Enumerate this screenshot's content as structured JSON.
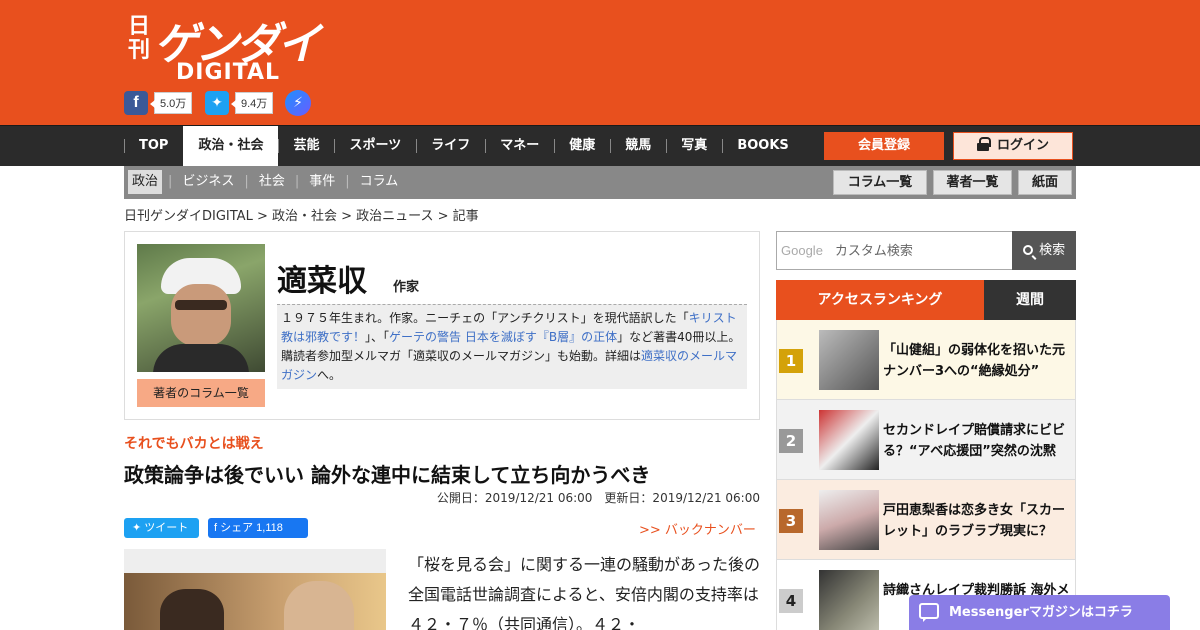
{
  "brand": {
    "logo_small": "日刊",
    "logo_big": "ゲンダイ",
    "logo_digital": "DIGITAL"
  },
  "social": {
    "facebook_count": "5.0万",
    "twitter_count": "9.4万"
  },
  "nav": {
    "items": [
      "TOP",
      "政治・社会",
      "芸能",
      "スポーツ",
      "ライフ",
      "マネー",
      "健康",
      "競馬",
      "写真",
      "BOOKS"
    ],
    "register": "会員登録",
    "login": "ログイン"
  },
  "subnav": {
    "items": [
      "政治",
      "ビジネス",
      "社会",
      "事件",
      "コラム"
    ],
    "buttons": [
      "コラム一覧",
      "著者一覧",
      "紙面"
    ]
  },
  "breadcrumb": "日刊ゲンダイDIGITAL > 政治・社会 > 政治ニュース > 記事",
  "author": {
    "name": "適菜収",
    "role": "作家",
    "column_button": "著者のコラム一覧",
    "bio_1": "１９７５年生まれ。作家。ニーチェの「アンチクリスト」を現代語訳した「",
    "bio_link_1": "キリスト教は邪教です！",
    "bio_2": "」、「",
    "bio_link_2": "ゲーテの警告 日本を滅ぼす『B層』の正体",
    "bio_3": "」など著書40冊以上。購読者参加型メルマガ「適菜収のメールマガジン」も始動。詳細は",
    "bio_link_3": "適菜収のメールマガジン",
    "bio_4": "へ。"
  },
  "article": {
    "kicker": "それでもバカとは戦え",
    "headline": "政策論争は後でいい 論外な連中に結束して立ち向かうべき",
    "dates": "公開日：2019/12/21 06:00　更新日：2019/12/21 06:00",
    "tweet": "ツイート",
    "share": "シェア 1,118",
    "back_number": ">> バックナンバー",
    "body": "「桜を見る会」に関する一連の騒動があった後の全国電話世論調査によると、安倍内閣の支持率は４２・７％（共同通信）。４２・"
  },
  "search": {
    "google_label": "Google",
    "placeholder": "カスタム検索",
    "button": "検索"
  },
  "ranking": {
    "tab_access": "アクセスランキング",
    "tab_weekly": "週間",
    "items": [
      {
        "rank": "1",
        "title": "「山健組」の弱体化を招いた元ナンバー3への“絶縁処分”"
      },
      {
        "rank": "2",
        "title": "セカンドレイプ賠償請求にビビる？“アベ応援団”突然の沈黙"
      },
      {
        "rank": "3",
        "title": "戸田恵梨香は恋多き女「スカーレット」のラブラブ現実に？"
      },
      {
        "rank": "4",
        "title": "詩織さんレイプ裁判勝訴 海外メディア"
      }
    ]
  },
  "messenger_banner": "Messengerマガジンはコチラ",
  "colors": {
    "brand": "#e8501e",
    "nav_bg": "#2b2b2b",
    "rank1": "#d4a20a",
    "rank2": "#999999",
    "rank3": "#b8682c",
    "rank4": "#cccccc"
  }
}
